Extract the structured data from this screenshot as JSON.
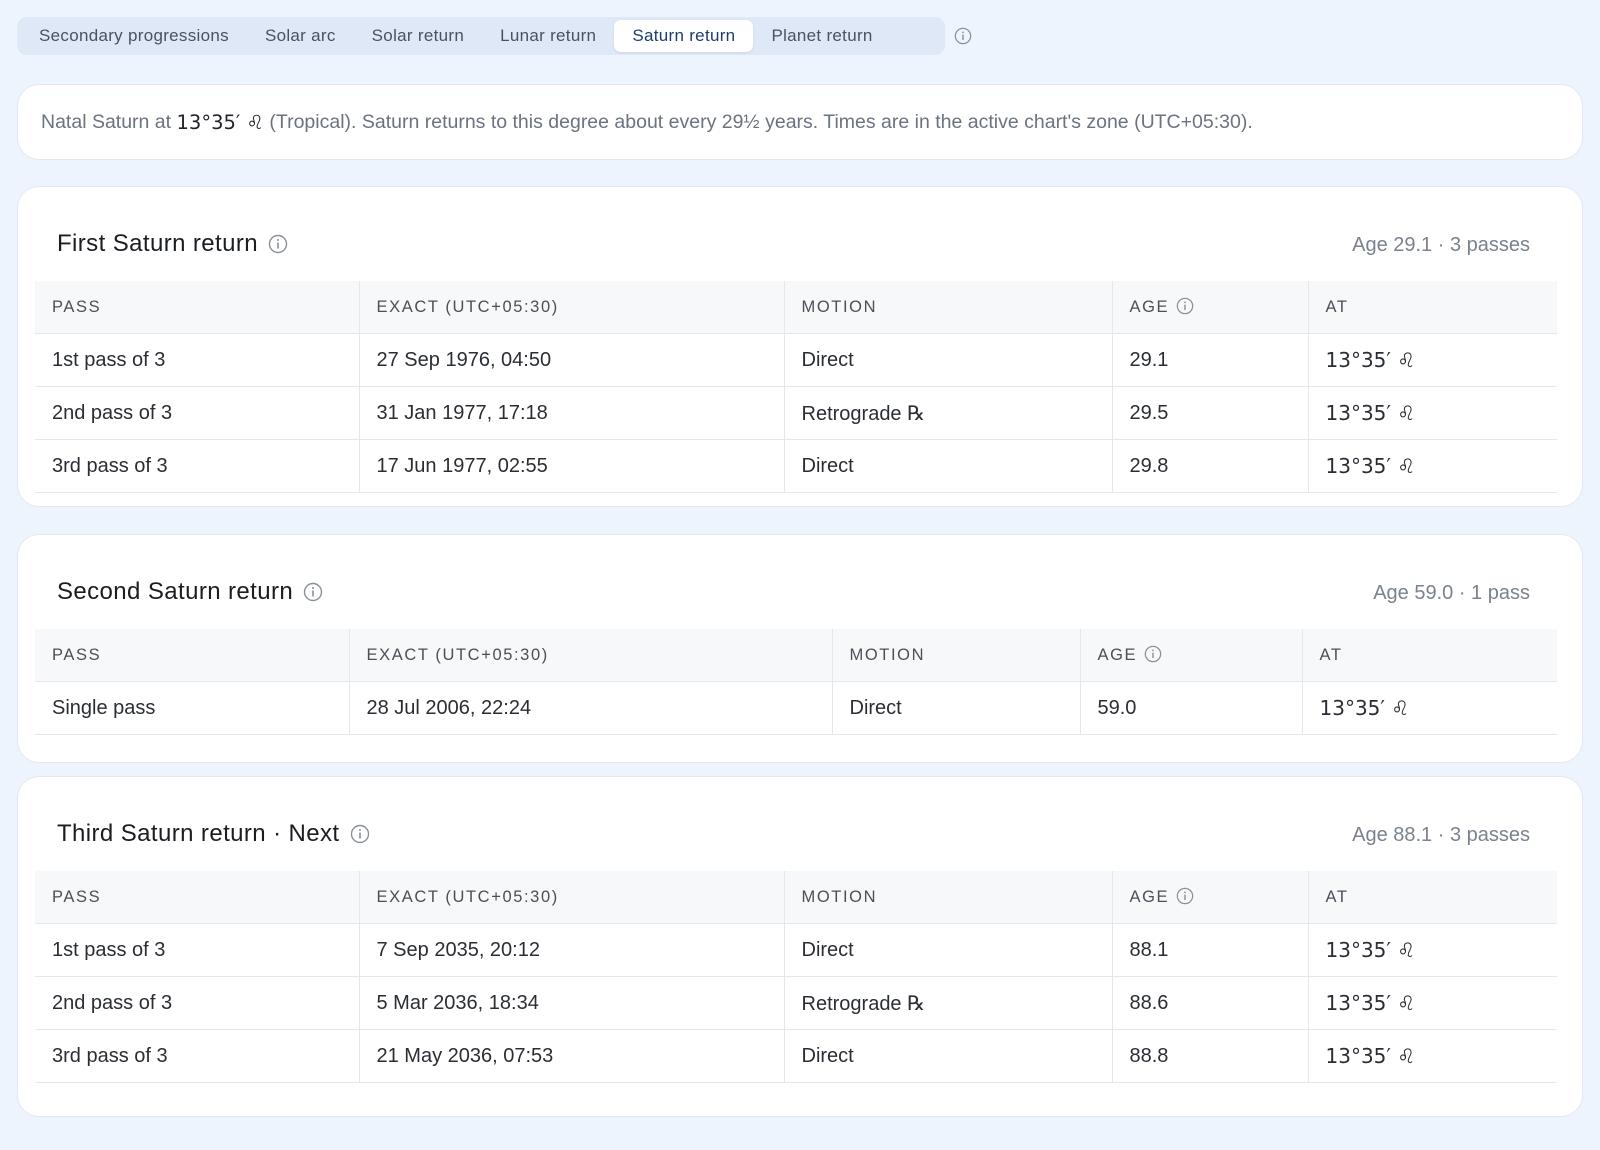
{
  "tabs": [
    {
      "label": "Secondary progressions",
      "active": false
    },
    {
      "label": "Solar arc",
      "active": false
    },
    {
      "label": "Solar return",
      "active": false
    },
    {
      "label": "Lunar return",
      "active": false
    },
    {
      "label": "Saturn return",
      "active": true
    },
    {
      "label": "Planet return",
      "active": false
    }
  ],
  "intro": {
    "prefix": "Natal Saturn at",
    "position": "13°35′ ♌︎",
    "suffix": "(Tropical). Saturn returns to this degree about every 29½ years. Times are in the active chart's zone (UTC+05:30)."
  },
  "columns": {
    "pass": "PASS",
    "exact": "EXACT (UTC+05:30)",
    "motion": "MOTION",
    "age": "AGE",
    "at": "AT"
  },
  "sections": [
    {
      "title": "First Saturn return",
      "meta": "Age 29.1 · 3 passes",
      "rows": [
        {
          "pass": "1st pass of 3",
          "exact": "27 Sep 1976, 04:50",
          "motion": "Direct",
          "age": "29.1",
          "at": "13°35′ ♌︎"
        },
        {
          "pass": "2nd pass of 3",
          "exact": "31 Jan 1977, 17:18",
          "motion": "Retrograde ℞",
          "age": "29.5",
          "at": "13°35′ ♌︎"
        },
        {
          "pass": "3rd pass of 3",
          "exact": "17 Jun 1977, 02:55",
          "motion": "Direct",
          "age": "29.8",
          "at": "13°35′ ♌︎"
        }
      ]
    },
    {
      "title": "Second Saturn return",
      "meta": "Age 59.0 · 1 pass",
      "rows": [
        {
          "pass": "Single pass",
          "exact": "28 Jul 2006, 22:24",
          "motion": "Direct",
          "age": "59.0",
          "at": "13°35′ ♌︎"
        }
      ]
    },
    {
      "title": "Third Saturn return · Next",
      "meta": "Age 88.1 · 3 passes",
      "rows": [
        {
          "pass": "1st pass of 3",
          "exact": "7 Sep 2035, 20:12",
          "motion": "Direct",
          "age": "88.1",
          "at": "13°35′ ♌︎"
        },
        {
          "pass": "2nd pass of 3",
          "exact": "5 Mar 2036, 18:34",
          "motion": "Retrograde ℞",
          "age": "88.6",
          "at": "13°35′ ♌︎"
        },
        {
          "pass": "3rd pass of 3",
          "exact": "21 May 2036, 07:53",
          "motion": "Direct",
          "age": "88.8",
          "at": "13°35′ ♌︎"
        }
      ]
    }
  ],
  "icons": {
    "info": "info-icon"
  },
  "colors": {
    "background": "#eef4fd",
    "tabbar": "#dfe8f6",
    "active_tab_text": "#1f3d6b",
    "retrograde": "#b42318"
  }
}
